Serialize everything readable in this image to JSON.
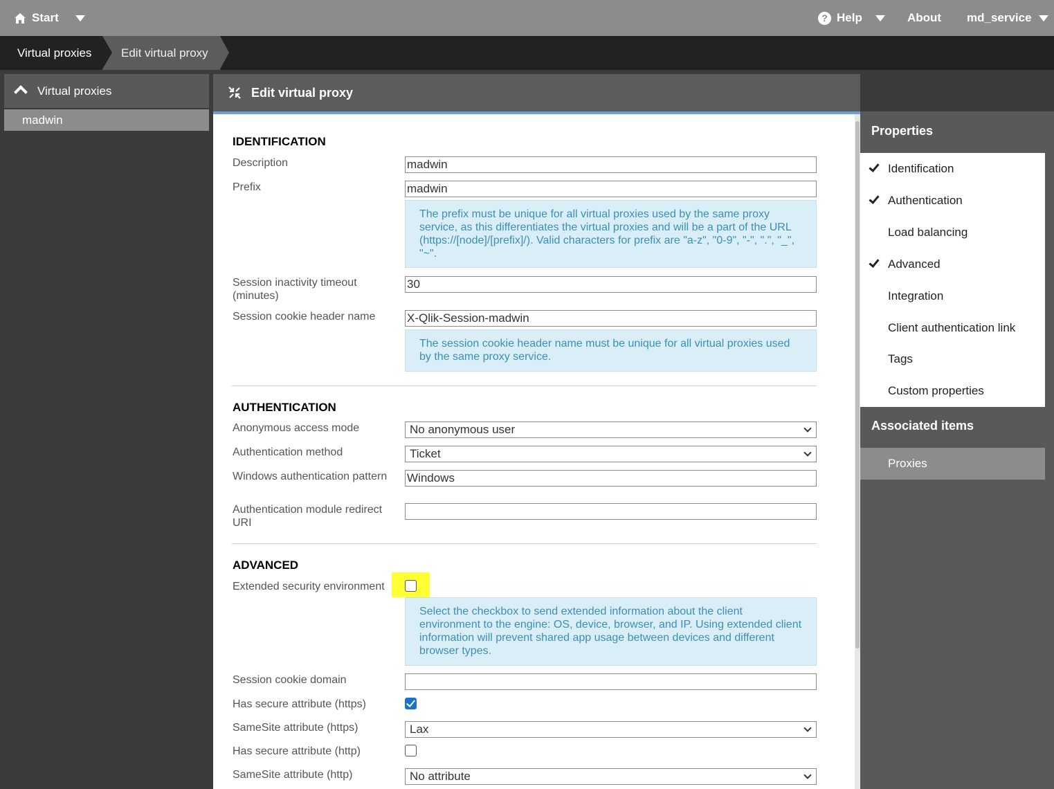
{
  "topbar": {
    "start_label": "Start",
    "help_label": "Help",
    "help_icon": "?",
    "about_label": "About",
    "user_label": "md_service"
  },
  "breadcrumb": {
    "items": [
      "Virtual proxies",
      "Edit virtual proxy"
    ]
  },
  "left_panel": {
    "header": "Virtual proxies",
    "items": [
      "madwin"
    ]
  },
  "page": {
    "title": "Edit virtual proxy"
  },
  "identification": {
    "title": "IDENTIFICATION",
    "description_label": "Description",
    "description_value": "madwin",
    "prefix_label": "Prefix",
    "prefix_value": "madwin",
    "prefix_info": "The prefix must be unique for all virtual proxies used by the same proxy service, as this differentiates the virtual proxies and will be a part of the URL (https://[node]/[prefix]/). Valid characters for prefix are \"a-z\", \"0-9\", \"-\", \".\", \"_\", \"~\".",
    "timeout_label": "Session inactivity timeout (minutes)",
    "timeout_value": "30",
    "cookie_header_label": "Session cookie header name",
    "cookie_header_value": "X-Qlik-Session-madwin",
    "cookie_header_info": "The session cookie header name must be unique for all virtual proxies used by the same proxy service."
  },
  "authentication": {
    "title": "AUTHENTICATION",
    "anon_label": "Anonymous access mode",
    "anon_value": "No anonymous user",
    "method_label": "Authentication method",
    "method_value": "Ticket",
    "win_pattern_label": "Windows authentication pattern",
    "win_pattern_value": "Windows",
    "redirect_label": "Authentication module redirect URI",
    "redirect_value": ""
  },
  "advanced": {
    "title": "ADVANCED",
    "ext_security_label": "Extended security environment",
    "ext_security_checked": false,
    "ext_security_info": "Select the checkbox to send extended information about the client environment to the engine: OS, device, browser, and IP. Using extended client information will prevent shared app usage between devices and different browser types.",
    "cookie_domain_label": "Session cookie domain",
    "cookie_domain_value": "",
    "secure_https_label": "Has secure attribute (https)",
    "secure_https_checked": true,
    "samesite_https_label": "SameSite attribute (https)",
    "samesite_https_value": "Lax",
    "secure_http_label": "Has secure attribute (http)",
    "secure_http_checked": false,
    "samesite_http_label": "SameSite attribute (http)",
    "samesite_http_value": "No attribute"
  },
  "right_panel": {
    "properties_title": "Properties",
    "properties": [
      {
        "label": "Identification",
        "checked": true
      },
      {
        "label": "Authentication",
        "checked": true
      },
      {
        "label": "Load balancing",
        "checked": false
      },
      {
        "label": "Advanced",
        "checked": true
      },
      {
        "label": "Integration",
        "checked": false
      },
      {
        "label": "Client authentication link",
        "checked": false
      },
      {
        "label": "Tags",
        "checked": false
      },
      {
        "label": "Custom properties",
        "checked": false
      }
    ],
    "associated_title": "Associated items",
    "associated_items": [
      "Proxies"
    ]
  },
  "colors": {
    "highlight": "#ffff33",
    "info_bg": "#daeef7",
    "info_text": "#3a8fb7",
    "checkbox_checked": "#1a73c9"
  }
}
